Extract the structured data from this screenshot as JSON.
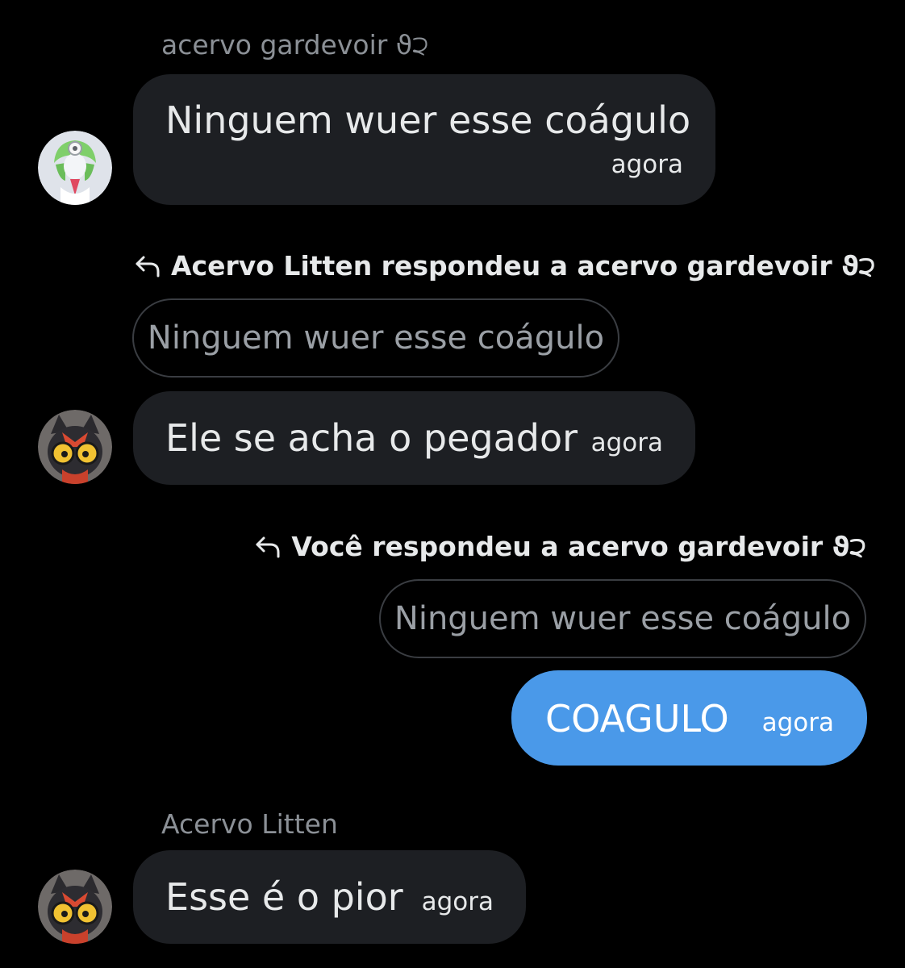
{
  "colors": {
    "background": "#000000",
    "bubble_other": "#1d1f23",
    "bubble_self": "#4a99e9",
    "muted_text": "#8b9096",
    "quote_border": "#3a3d42"
  },
  "messages": [
    {
      "sender_name": "acervo gardevoir ϑ੨",
      "avatar_icon": "gardevoir-avatar-icon",
      "text": "Ninguem wuer esse coágulo",
      "time": "agora"
    },
    {
      "reply_header": "Acervo Litten respondeu a acervo gardevoir ϑ੨",
      "reply_icon": "reply-arrow-icon",
      "quoted_text": "Ninguem wuer esse coágulo",
      "avatar_icon": "litten-avatar-icon",
      "text": "Ele se acha o pegador",
      "time": "agora"
    },
    {
      "reply_header": "Você respondeu a acervo gardevoir ϑ੨",
      "reply_icon": "reply-arrow-icon",
      "quoted_text": "Ninguem wuer esse coágulo",
      "text": "COAGULO",
      "time": "agora"
    },
    {
      "sender_name": "Acervo Litten",
      "avatar_icon": "litten-avatar-icon",
      "text": "Esse é o pior",
      "time": "agora"
    }
  ]
}
